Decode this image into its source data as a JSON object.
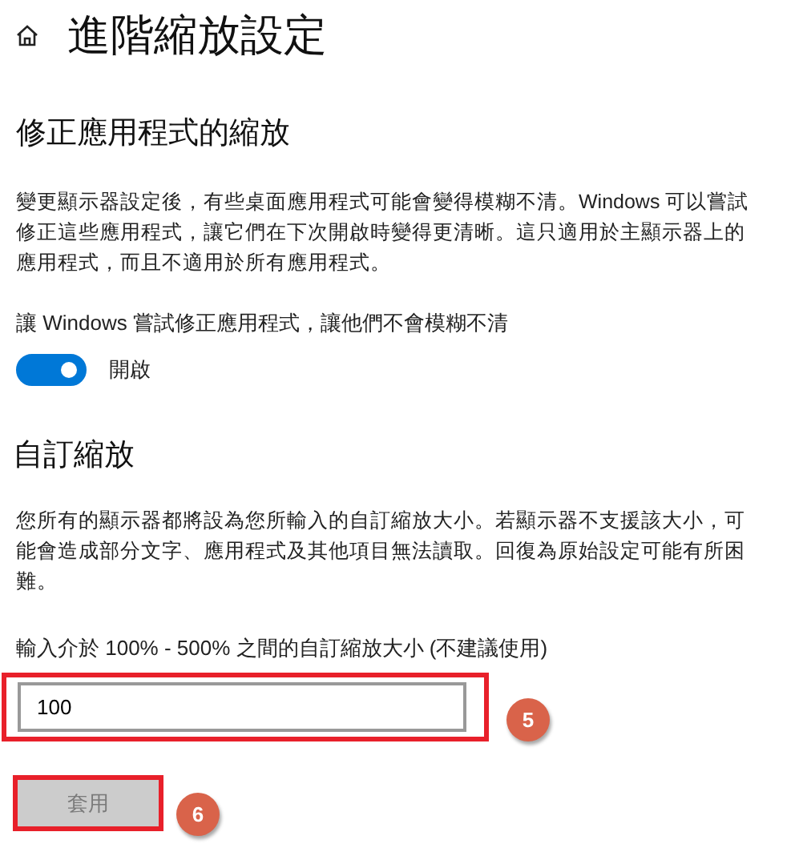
{
  "page": {
    "title": "進階縮放設定"
  },
  "fix_section": {
    "heading": "修正應用程式的縮放",
    "description": "變更顯示器設定後，有些桌面應用程式可能會變得模糊不清。Windows 可以嘗試修正這些應用程式，讓它們在下次開啟時變得更清晰。這只適用於主顯示器上的應用程式，而且不適用於所有應用程式。",
    "toggle": {
      "label": "讓 Windows 嘗試修正應用程式，讓他們不會模糊不清",
      "on": true,
      "state_text": "開啟"
    }
  },
  "custom_section": {
    "heading": "自訂縮放",
    "description": "您所有的顯示器都將設為您所輸入的自訂縮放大小。若顯示器不支援該大小，可能會造成部分文字、應用程式及其他項目無法讀取。回復為原始設定可能有所困難。",
    "field_label": "輸入介於 100% - 500% 之間的自訂縮放大小 (不建議使用)",
    "field_value": "100",
    "apply_button": {
      "label": "套用",
      "disabled": true
    }
  },
  "annotations": [
    {
      "label": "5"
    },
    {
      "label": "6"
    }
  ]
}
